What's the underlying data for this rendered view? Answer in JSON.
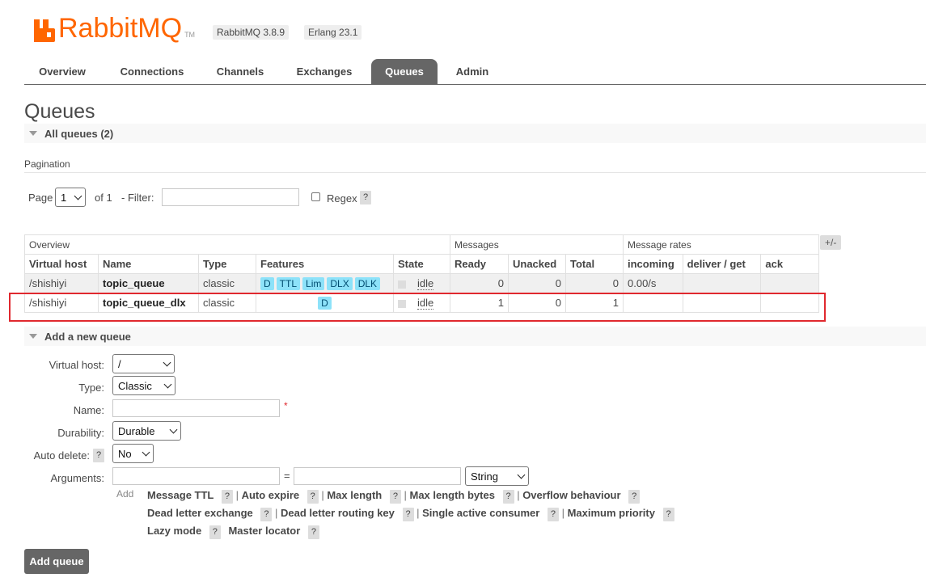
{
  "header": {
    "logo_text": "RabbitMQ",
    "logo_tm": "TM",
    "version_badge": "RabbitMQ 3.8.9",
    "erlang_badge": "Erlang 23.1"
  },
  "tabs": [
    {
      "label": "Overview",
      "active": false
    },
    {
      "label": "Connections",
      "active": false
    },
    {
      "label": "Channels",
      "active": false
    },
    {
      "label": "Exchanges",
      "active": false
    },
    {
      "label": "Queues",
      "active": true
    },
    {
      "label": "Admin",
      "active": false
    }
  ],
  "page_title": "Queues",
  "all_queues": {
    "label": "All queues (2)"
  },
  "pagination": {
    "label": "Pagination",
    "page_label": "Page",
    "page_value": "1",
    "of_label": "of 1",
    "filter_label": "- Filter:",
    "filter_value": "",
    "regex_label": "Regex",
    "help": "?"
  },
  "table": {
    "groups": [
      "Overview",
      "Messages",
      "Message rates"
    ],
    "columns": [
      "Virtual host",
      "Name",
      "Type",
      "Features",
      "State",
      "Ready",
      "Unacked",
      "Total",
      "incoming",
      "deliver / get",
      "ack"
    ],
    "plus_minus": "+/-",
    "rows": [
      {
        "vhost": "/shishiyi",
        "name": "topic_queue",
        "type": "classic",
        "features": [
          "D",
          "TTL",
          "Lim",
          "DLX",
          "DLK"
        ],
        "state": "idle",
        "ready": "0",
        "unacked": "0",
        "total": "0",
        "incoming": "0.00/s",
        "deliver": "",
        "ack": ""
      },
      {
        "vhost": "/shishiyi",
        "name": "topic_queue_dlx",
        "type": "classic",
        "features": [
          "D"
        ],
        "state": "idle",
        "ready": "1",
        "unacked": "0",
        "total": "1",
        "incoming": "",
        "deliver": "",
        "ack": ""
      }
    ]
  },
  "highlight_color": "#e0282e",
  "add_queue": {
    "section_label": "Add a new queue",
    "virtual_host_label": "Virtual host:",
    "virtual_host_value": "/",
    "type_label": "Type:",
    "type_value": "Classic",
    "name_label": "Name:",
    "name_value": "",
    "required_mark": "*",
    "durability_label": "Durability:",
    "durability_value": "Durable",
    "auto_delete_label": "Auto delete:",
    "auto_delete_help": "?",
    "auto_delete_value": "No",
    "arguments_label": "Arguments:",
    "arg_key_value": "",
    "equals": "=",
    "arg_val_value": "",
    "arg_type_value": "String",
    "add_label": "Add",
    "arg_links": [
      "Message TTL",
      "Auto expire",
      "Max length",
      "Max length bytes",
      "Overflow behaviour",
      "Dead letter exchange",
      "Dead letter routing key",
      "Single active consumer",
      "Maximum priority",
      "Lazy mode",
      "Master locator"
    ],
    "submit_label": "Add queue"
  },
  "colors": {
    "accent": "#ff6600",
    "tab_active": "#666666",
    "feature_badge": "#8de2f9"
  }
}
